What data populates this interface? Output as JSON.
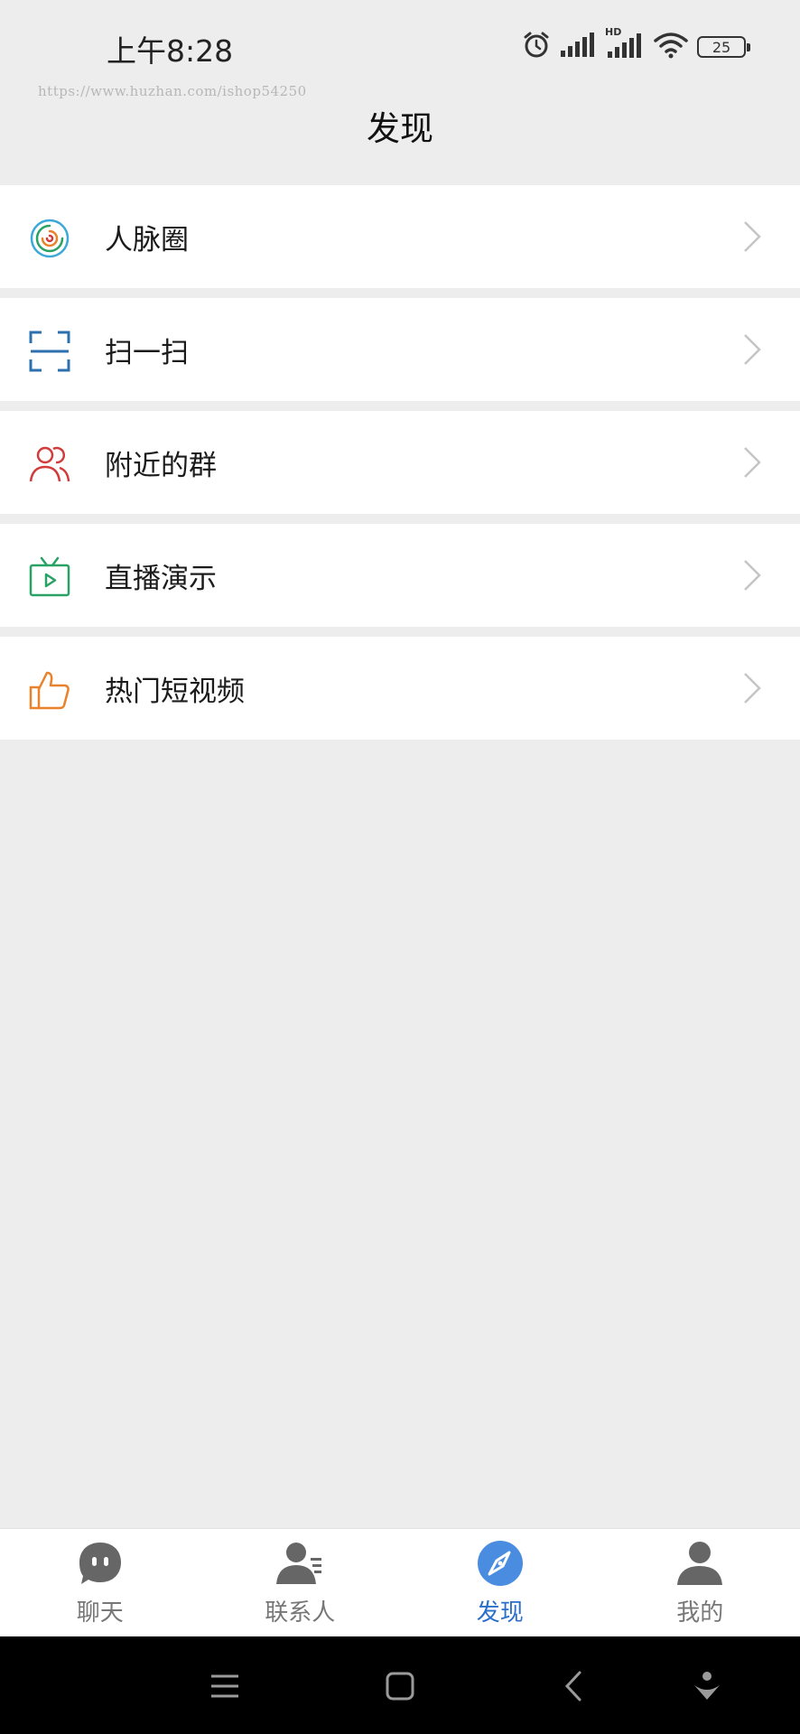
{
  "status_bar": {
    "time": "上午8:28",
    "battery_level": "25",
    "hd_label": "HD",
    "icons": [
      "alarm-icon",
      "signal-icon",
      "hd-signal-icon",
      "wifi-icon",
      "battery-icon"
    ]
  },
  "watermark": "https://www.huzhan.com/ishop54250",
  "header": {
    "title": "发现"
  },
  "menu": {
    "items": [
      {
        "label": "人脉圈",
        "icon": "circle-swirl-icon",
        "color": "#3da9d8"
      },
      {
        "label": "扫一扫",
        "icon": "scan-icon",
        "color": "#2e6fad"
      },
      {
        "label": "附近的群",
        "icon": "people-group-icon",
        "color": "#d23b3b"
      },
      {
        "label": "直播演示",
        "icon": "tv-live-icon",
        "color": "#2aa266"
      },
      {
        "label": "热门短视频",
        "icon": "thumbs-up-icon",
        "color": "#e9822b"
      }
    ]
  },
  "tabs": [
    {
      "label": "聊天",
      "icon": "chat-bubble-icon",
      "active": false
    },
    {
      "label": "联系人",
      "icon": "contacts-icon",
      "active": false
    },
    {
      "label": "发现",
      "icon": "compass-icon",
      "active": true
    },
    {
      "label": "我的",
      "icon": "person-icon",
      "active": false
    }
  ],
  "colors": {
    "background": "#ededed",
    "accent": "#2b6fcc",
    "tab_inactive": "#777777",
    "nav_bar": "#000000"
  },
  "system_nav": [
    "menu-icon",
    "home-icon",
    "back-icon",
    "assistant-icon"
  ]
}
